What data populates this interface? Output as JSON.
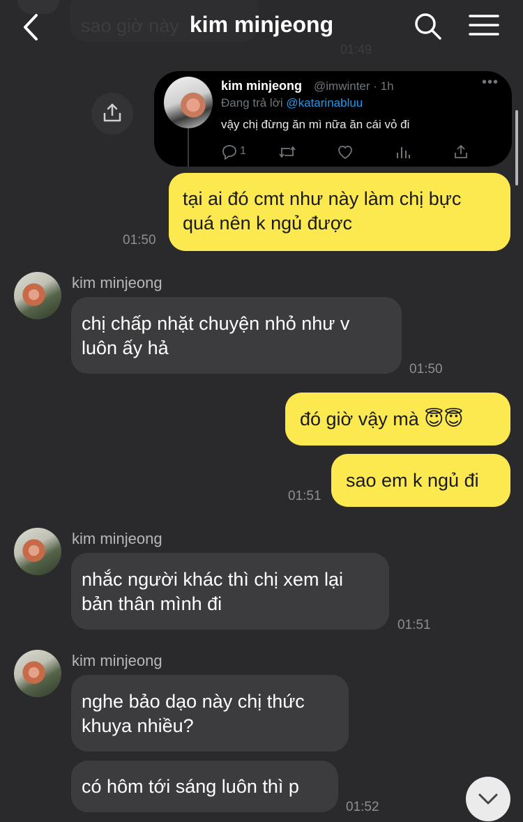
{
  "header": {
    "title": "kim minjeong",
    "back_icon": "chevron-left-icon",
    "search_icon": "search-icon",
    "menu_icon": "hamburger-menu-icon",
    "ghost_text": "sao giờ này",
    "ghost_time": "01:49"
  },
  "share_icon": "share-icon",
  "tweet": {
    "name": "kim minjeong",
    "handle": "@imwinter · 1h",
    "more": "•••",
    "reply_prefix": "Đang trả lời",
    "reply_mention": "@katarinabluu",
    "text": "vậy chị đừng ăn mì nữa ăn cái vỏ đi",
    "reply_count": "1"
  },
  "messages": [
    {
      "from": "me",
      "lines": [
        "tại ai đó cmt như này làm chị bực",
        "quá nên k ngủ được"
      ],
      "time": "01:50"
    },
    {
      "from": "them",
      "sender": "kim minjeong",
      "lines": [
        "chị chấp nhặt chuyện nhỏ như v",
        "luôn ấy hả"
      ],
      "time": "01:50"
    },
    {
      "from": "me",
      "lines": [
        "đó giờ vậy mà 😇😇"
      ]
    },
    {
      "from": "me",
      "lines": [
        "sao em k ngủ đi"
      ],
      "time": "01:51"
    },
    {
      "from": "them",
      "sender": "kim minjeong",
      "lines": [
        "nhắc người khác thì chị xem lại",
        "bản thân mình đi"
      ],
      "time": "01:51"
    },
    {
      "from": "them",
      "sender": "kim minjeong",
      "lines": [
        "nghe bảo dạo này chị thức",
        "khuya nhiều?"
      ]
    },
    {
      "from": "them",
      "lines": [
        "có hôm tới sáng luôn thì p"
      ],
      "time": "01:52"
    }
  ],
  "scroll_down_icon": "chevron-down-icon",
  "colors": {
    "background": "#2a2a2c",
    "my_bubble": "#fce94f",
    "their_bubble": "#3c3c3e",
    "mention": "#1d9bf0"
  }
}
